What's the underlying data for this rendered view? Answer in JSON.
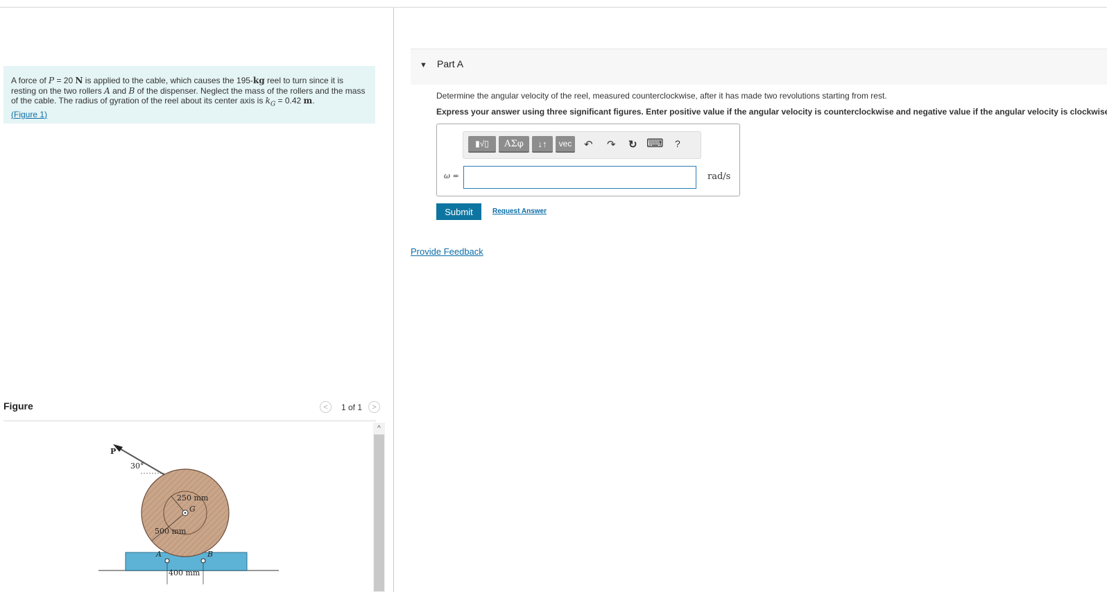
{
  "problem": {
    "t1": "A force of ",
    "p_sym": "P",
    "t2": " = 20 ",
    "n_unit": "N",
    "t3": " is applied to the cable, which causes the 195-",
    "kg_unit": "kg",
    "t4": " reel to turn since it is resting on the two rollers ",
    "a_sym": "A",
    "t5": " and ",
    "b_sym": "B",
    "t6": " of the dispenser. Neglect the mass of the rollers and the mass of the cable. The radius of gyration of the reel about its center axis is ",
    "k_sym": "k",
    "k_sub": "G",
    "t7": " = 0.42 ",
    "m_unit": "m",
    "t8": ".",
    "figure_link_open": "(",
    "figure_link": "Figure 1",
    "figure_link_close": ")"
  },
  "figure": {
    "title": "Figure",
    "counter": "1 of 1",
    "prev_glyph": "<",
    "next_glyph": ">",
    "scroll_up_glyph": "^",
    "labels": {
      "force": "P",
      "angle": "30°",
      "inner_radius": "250 mm",
      "center": "G",
      "outer_radius": "500 mm",
      "roller_a": "A",
      "roller_b": "B",
      "spacing": "400 mm"
    }
  },
  "part_a": {
    "label": "Part A",
    "question": "Determine the angular velocity of the reel, measured counterclockwise, after it has made two revolutions starting from rest.",
    "instructions": "Express your answer using three significant figures. Enter positive value if the angular velocity is counterclockwise and negative value if the angular velocity is clockwise.",
    "toolbar": {
      "templates": "▮√▯",
      "greek": "ΑΣφ",
      "arrows": "↓↑",
      "vec": "vec",
      "undo": "↶",
      "redo": "↷",
      "reset": "↻",
      "keyboard": "⌨",
      "help": "?"
    },
    "variable": "ω =",
    "answer_value": "",
    "units": "rad/s",
    "submit": "Submit",
    "request": "Request Answer"
  },
  "feedback": "Provide Feedback"
}
